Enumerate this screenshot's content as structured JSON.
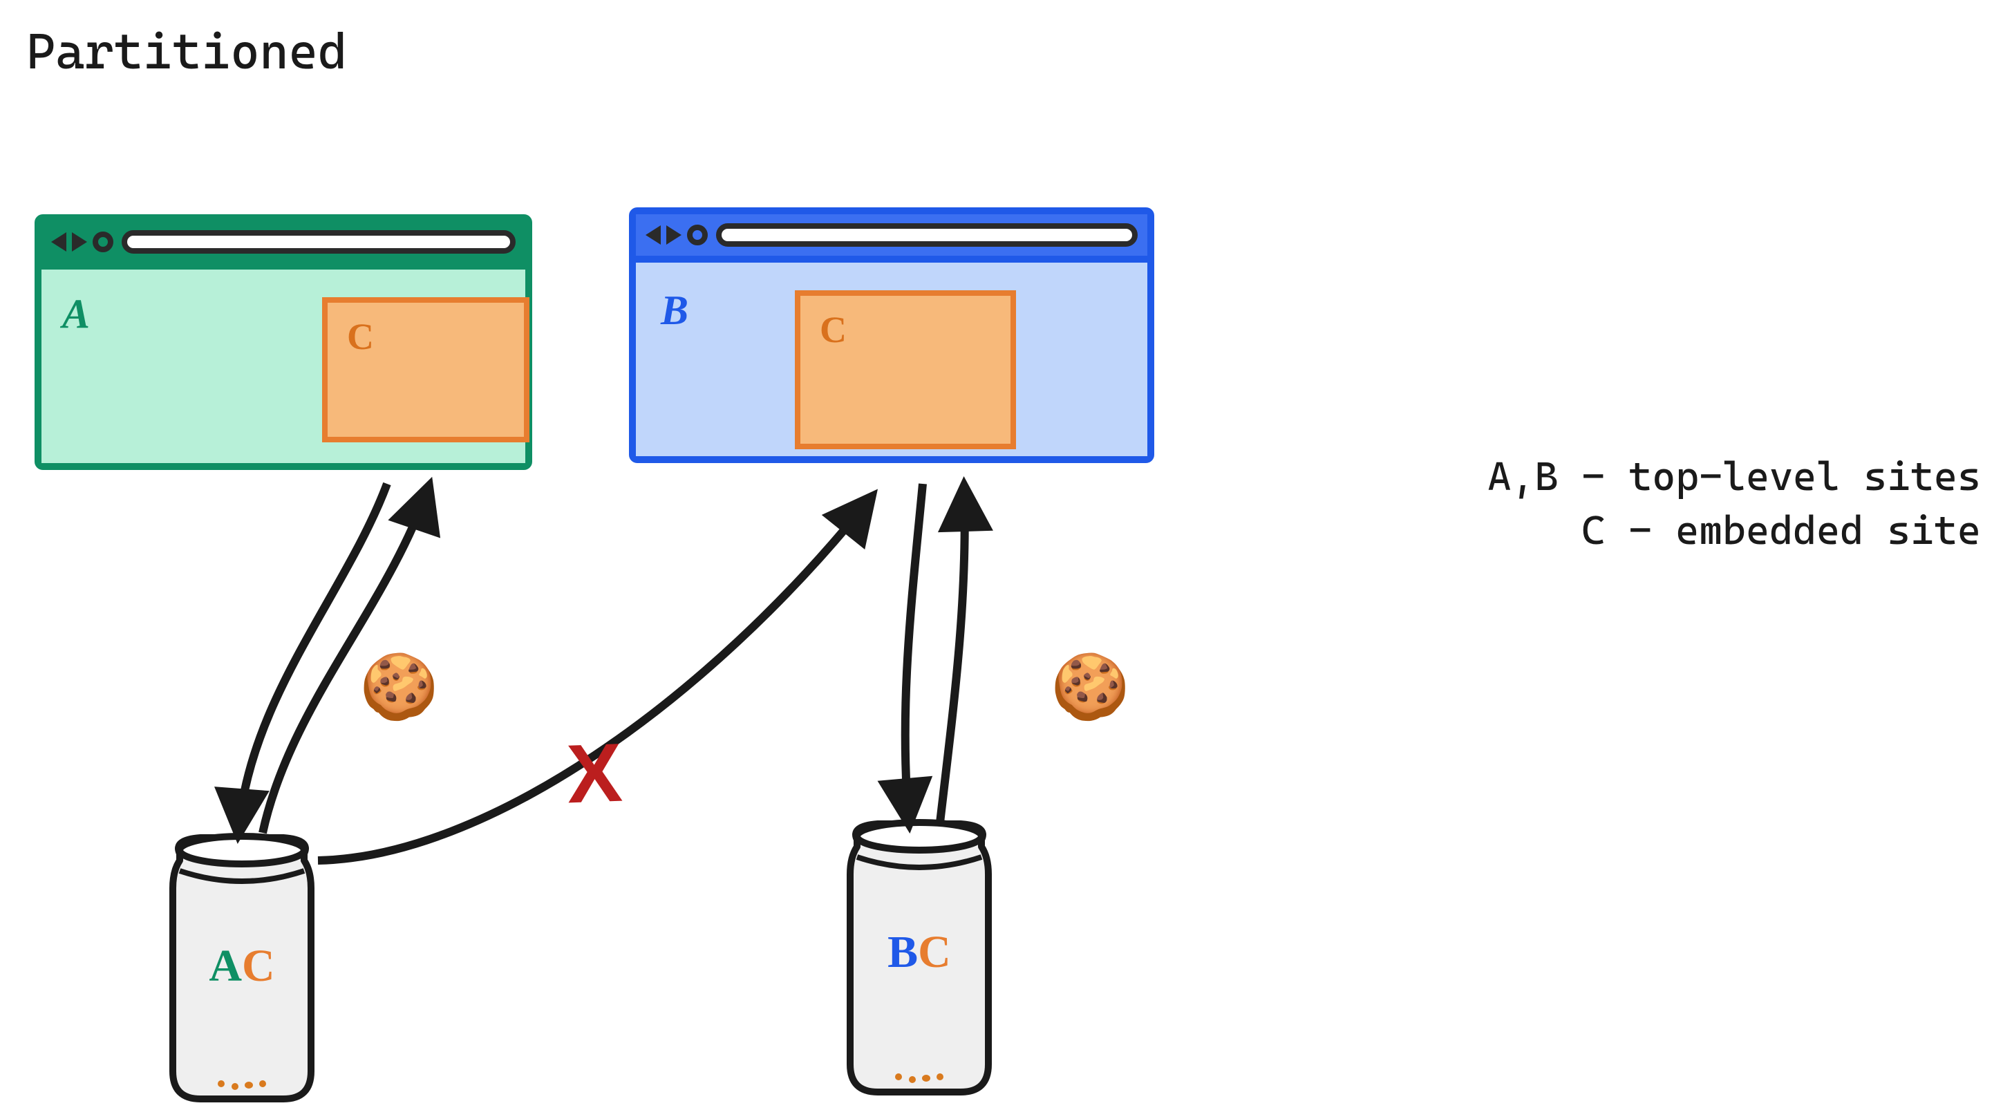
{
  "title": "Partitioned",
  "legend": {
    "row1": "A,B - top-level sites",
    "row2": "  C - embedded site"
  },
  "browsers": {
    "A": {
      "label": "A",
      "color": "#0f8f64",
      "embed_label": "C"
    },
    "B": {
      "label": "B",
      "color": "#1f59e8",
      "embed_label": "C"
    }
  },
  "jars": {
    "A": {
      "label_a": "A",
      "label_c": "C"
    },
    "B": {
      "label_b": "B",
      "label_c": "C"
    }
  },
  "cookie_glyph": "🍪",
  "blocked_marker": "X",
  "colors": {
    "siteA": "#0f8f64",
    "siteB": "#1f59e8",
    "siteC": "#e77d2f",
    "blocked": "#bb1e1e",
    "stroke": "#1a1a1a"
  }
}
